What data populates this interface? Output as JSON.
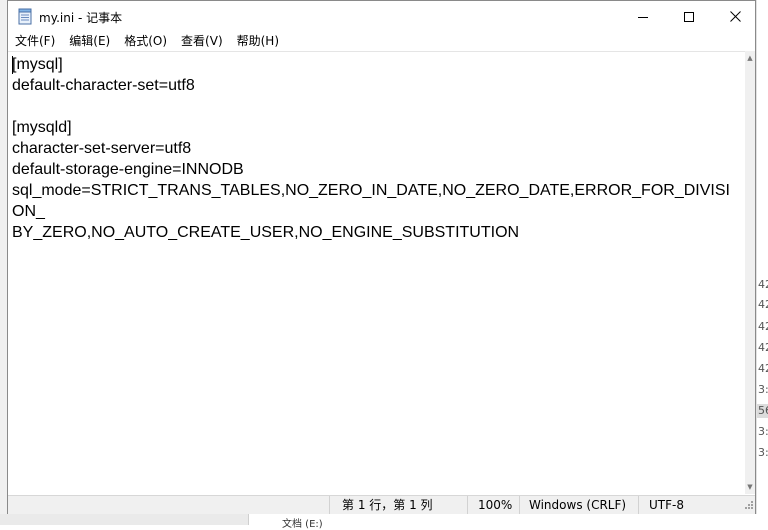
{
  "window": {
    "title": "my.ini - 记事本",
    "icon": "notepad-icon"
  },
  "title_buttons": {
    "minimize": "minimize-icon",
    "maximize": "maximize-icon",
    "close": "close-icon"
  },
  "menu": {
    "items": [
      {
        "label": "文件(F)"
      },
      {
        "label": "编辑(E)"
      },
      {
        "label": "格式(O)"
      },
      {
        "label": "查看(V)"
      },
      {
        "label": "帮助(H)"
      }
    ]
  },
  "editor": {
    "content": "[mysql]\ndefault-character-set=utf8\n\n[mysqld]\ncharacter-set-server=utf8\ndefault-storage-engine=INNODB\nsql_mode=STRICT_TRANS_TABLES,NO_ZERO_IN_DATE,NO_ZERO_DATE,ERROR_FOR_DIVISION_\nBY_ZERO,NO_AUTO_CREATE_USER,NO_ENGINE_SUBSTITUTION"
  },
  "statusbar": {
    "position": "第 1 行，第 1 列",
    "zoom": "100%",
    "line_ending": "Windows (CRLF)",
    "encoding": "UTF-8"
  },
  "background": {
    "right_column_fragments": [
      "42",
      "42",
      "42",
      "42",
      "42",
      "3:",
      "56",
      "3:",
      "3:"
    ],
    "bottom_label": "文档 (E:)"
  },
  "colors": {
    "window_bg": "#ffffff",
    "statusbar_bg": "#f0f0f0",
    "text": "#000000"
  }
}
